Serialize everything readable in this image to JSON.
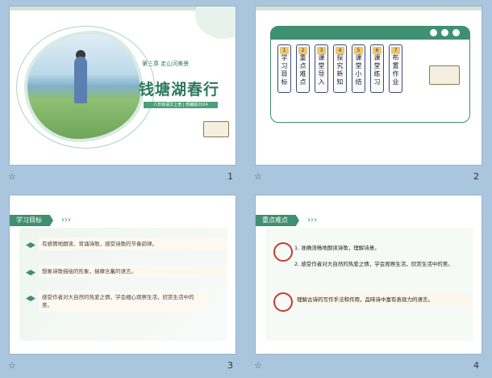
{
  "slides": [
    {
      "number": "1",
      "chapter": "第三章 走山河美景",
      "title": "钱塘湖春行",
      "subtitle": "八年级语文上册 | 部编版2024"
    },
    {
      "number": "2",
      "items": [
        {
          "n": "1",
          "label": "学习目标"
        },
        {
          "n": "2",
          "label": "重点难点"
        },
        {
          "n": "3",
          "label": "课堂导入"
        },
        {
          "n": "4",
          "label": "探究新知"
        },
        {
          "n": "5",
          "label": "课堂小结"
        },
        {
          "n": "6",
          "label": "课堂练习"
        },
        {
          "n": "7",
          "label": "布置作业"
        }
      ]
    },
    {
      "number": "3",
      "header": "学习目标",
      "goals": [
        "有感情地朗读、背诵诗歌，感受诗歌的节奏韵律。",
        "想象诗歌描绘的形象，揣摩含蓄的语言。",
        "感受作者对大自然的热爱之情，学会细心观察生活，欣赏生活中的美。"
      ]
    },
    {
      "number": "4",
      "header": "重点难点",
      "points": [
        "1. 准确流畅地朗读诗歌，理解诗意。",
        "2. 感受作者对大自然的热爱之情，学会观察生活，欣赏生活中的美。",
        "理解古诗的写作手法和作用，品味诗中富有表现力的语言。"
      ]
    }
  ],
  "star_icon": "☆"
}
